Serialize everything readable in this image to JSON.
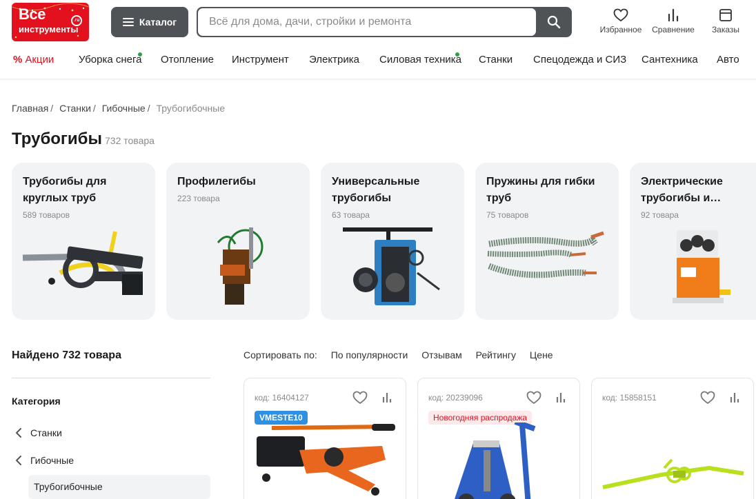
{
  "header": {
    "logo": {
      "line1": "Все",
      "line2": "инструменты",
      "badge": ".ru"
    },
    "catalog_label": "Каталог",
    "search_placeholder": "Всё для дома, дачи, стройки и ремонта",
    "icons": [
      {
        "label": "Избранное",
        "icon": "heart-icon"
      },
      {
        "label": "Сравнение",
        "icon": "compare-icon"
      },
      {
        "label": "Заказы",
        "icon": "orders-icon"
      }
    ]
  },
  "nav": [
    {
      "label": "Акции",
      "promo": true
    },
    {
      "label": "Уборка снега",
      "dot": true
    },
    {
      "label": "Отопление"
    },
    {
      "label": "Инструмент"
    },
    {
      "label": "Электрика"
    },
    {
      "label": "Силовая техника",
      "dot": true
    },
    {
      "label": "Станки"
    },
    {
      "label": "Спецодежда и СИЗ"
    },
    {
      "label": "Сантехника"
    },
    {
      "label": "Авто"
    }
  ],
  "breadcrumbs": [
    "Главная",
    "Станки",
    "Гибочные",
    "Трубогибочные"
  ],
  "page": {
    "title": "Трубогибы",
    "count": "732 товара"
  },
  "categories": [
    {
      "title": "Трубогибы для круглых труб",
      "count": "589 товаров"
    },
    {
      "title": "Профилегибы",
      "count": "223 товара"
    },
    {
      "title": "Универсальные трубогибы",
      "count": "63 товара"
    },
    {
      "title": "Пружины для гибки труб",
      "count": "75 товаров"
    },
    {
      "title": "Электрические трубогибы и…",
      "count": "92 товара"
    }
  ],
  "sidebar": {
    "found": "Найдено 732 товара",
    "category_heading": "Категория",
    "links": [
      "Станки",
      "Гибочные"
    ],
    "active": "Трубогибочные"
  },
  "sort": {
    "label": "Сортировать по:",
    "options": [
      "По популярности",
      "Отзывам",
      "Рейтингу",
      "Цене"
    ]
  },
  "products": [
    {
      "code": "код: 16404127",
      "badge": "VMESTE10",
      "badge_style": "blue"
    },
    {
      "code": "код: 20239096",
      "badge": "Новогодняя распродажа",
      "badge_style": "pink"
    },
    {
      "code": "код: 15858151",
      "badge": "",
      "badge_style": ""
    }
  ],
  "colors": {
    "brand_red": "#e3101e",
    "dark_button": "#4f5257",
    "card_bg": "#f2f3f5",
    "new_dot": "#2ea043",
    "badge_blue": "#2f8fe0"
  }
}
